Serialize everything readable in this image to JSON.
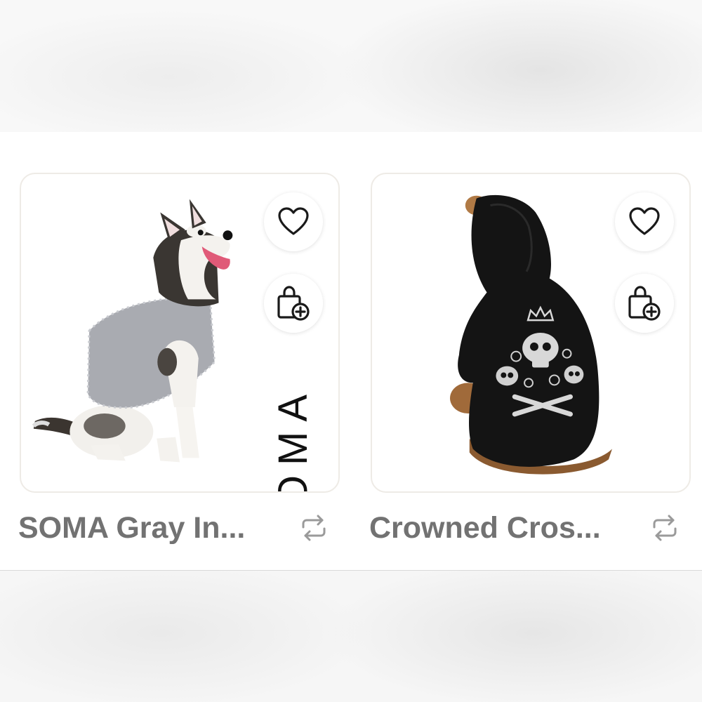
{
  "products": [
    {
      "title": "SOMA Gray In...",
      "brand_watermark": "SOMA",
      "image_icon": "husky-in-gray-sweater-image",
      "like_icon": "heart-icon",
      "bag_icon": "add-to-bag-icon",
      "swap_icon": "repost-icon"
    },
    {
      "title": "Crowned Cros...",
      "image_icon": "dog-in-black-skull-hoodie-image",
      "like_icon": "heart-icon",
      "bag_icon": "add-to-bag-icon",
      "swap_icon": "repost-icon"
    }
  ],
  "colors": {
    "title_text": "#727272",
    "card_border": "#eeebe6",
    "icon_stroke": "#1a1a1a"
  }
}
